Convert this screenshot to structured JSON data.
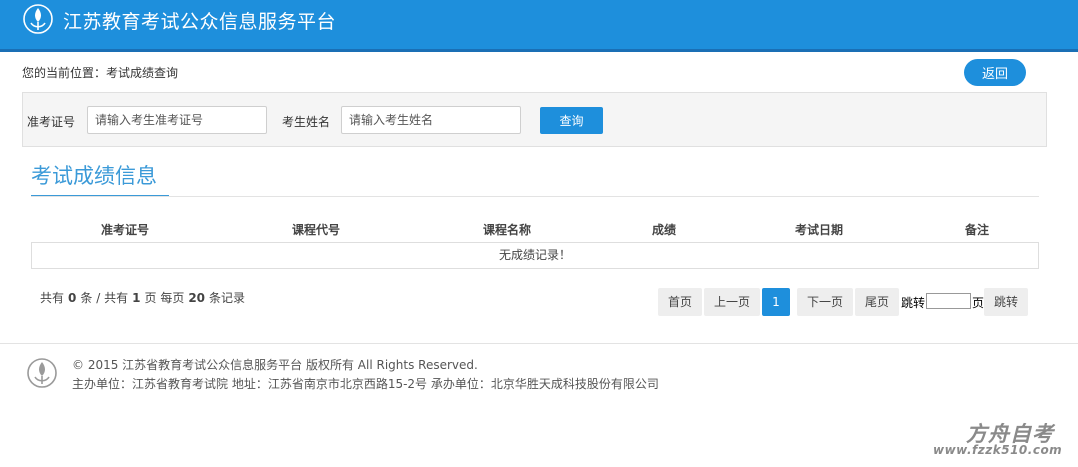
{
  "header": {
    "title": "江苏教育考试公众信息服务平台"
  },
  "breadcrumb": "您的当前位置：考试成绩查询",
  "back_label": "返回",
  "search": {
    "ticket_label": "准考证号",
    "ticket_placeholder": "请输入考生准考证号",
    "name_label": "考生姓名",
    "name_placeholder": "请输入考生姓名",
    "query_label": "查询"
  },
  "section_title": "考试成绩信息",
  "table": {
    "columns": [
      "准考证号",
      "课程代号",
      "课程名称",
      "成绩",
      "考试日期",
      "备注"
    ],
    "empty_message": "无成绩记录！"
  },
  "summary": {
    "prefix": "共有",
    "count": "0",
    "count_unit": "条",
    "sep": "/",
    "pages_prefix": "共有",
    "pages": "1",
    "pages_unit": "页",
    "per_prefix": "每页",
    "per_page": "20",
    "per_unit": "条记录"
  },
  "pagination": {
    "first": "首页",
    "prev": "上一页",
    "current": "1",
    "next": "下一页",
    "last": "尾页",
    "jump_label": "跳转",
    "page_unit": "页",
    "jump_button": "跳转"
  },
  "footer": {
    "copyright": "© 2015 江苏省教育考试公众信息服务平台 版权所有 All Rights Reserved.",
    "info": "主办单位：江苏省教育考试院 地址：江苏省南京市北京西路15-2号 承办单位：北京华胜天成科技股份有限公司"
  },
  "watermark": {
    "name": "方舟自考",
    "url": "www.fzzk510.com"
  },
  "colors": {
    "brand_blue": "#1e8fdc",
    "title_blue": "#3b9ad8"
  }
}
